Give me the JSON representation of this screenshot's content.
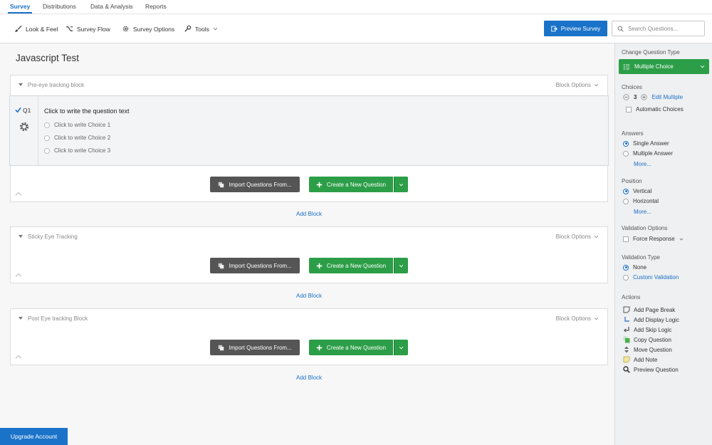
{
  "topnav": {
    "tabs": [
      "Survey",
      "Distributions",
      "Data & Analysis",
      "Reports"
    ]
  },
  "toolbar": {
    "look_feel": "Look & Feel",
    "survey_flow": "Survey Flow",
    "survey_options": "Survey Options",
    "tools": "Tools",
    "preview": "Preview Survey",
    "search_placeholder": "Search Questions..."
  },
  "survey": {
    "title": "Javascript Test"
  },
  "blocks": [
    {
      "name": "Pre-eye tracking block",
      "options": "Block Options"
    },
    {
      "name": "Sticky Eye Tracking",
      "options": "Block Options"
    },
    {
      "name": "Post Eye tracking Block",
      "options": "Block Options"
    }
  ],
  "question": {
    "number": "Q1",
    "text": "Click to write the question text",
    "choices": [
      "Click to write Choice 1",
      "Click to write Choice 2",
      "Click to write Choice 3"
    ]
  },
  "buttons": {
    "import": "Import Questions From...",
    "create": "Create a New Question",
    "add_block": "Add Block"
  },
  "sidebar": {
    "change_type_label": "Change Question Type",
    "type_value": "Multiple Choice",
    "choices_label": "Choices",
    "choices_count": "3",
    "edit_multiple": "Edit Multiple",
    "automatic_choices": "Automatic Choices",
    "answers_label": "Answers",
    "single_answer": "Single Answer",
    "multiple_answer": "Multiple Answer",
    "more": "More...",
    "position_label": "Position",
    "vertical": "Vertical",
    "horizontal": "Horizontal",
    "validation_options_label": "Validation Options",
    "force_response": "Force Response",
    "validation_type_label": "Validation Type",
    "none": "None",
    "custom_validation": "Custom Validation",
    "actions_label": "Actions",
    "actions": [
      "Add Page Break",
      "Add Display Logic",
      "Add Skip Logic",
      "Copy Question",
      "Move Question",
      "Add Note",
      "Preview Question"
    ]
  },
  "footer": {
    "upgrade": "Upgrade Account"
  },
  "colors": {
    "accent_blue": "#1a73c9",
    "accent_green": "#2c9e48",
    "dark_button": "#555555"
  }
}
